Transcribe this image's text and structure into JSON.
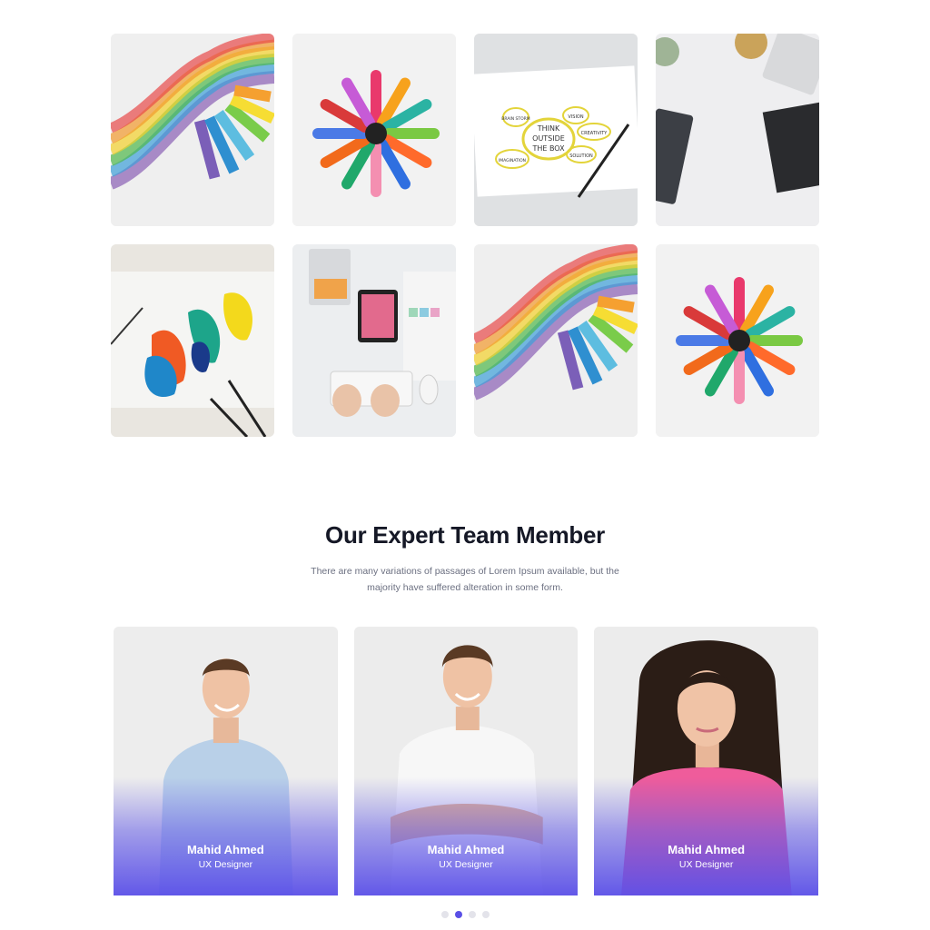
{
  "gallery": {
    "tiles": [
      {
        "alt": "rainbow chalk"
      },
      {
        "alt": "colored markers"
      },
      {
        "alt": "think outside the box"
      },
      {
        "alt": "desk workspace"
      },
      {
        "alt": "paint on paper"
      },
      {
        "alt": "designer desk"
      },
      {
        "alt": "rainbow chalk"
      },
      {
        "alt": "colored markers"
      }
    ],
    "sketch_text": [
      "THINK",
      "OUTSIDE",
      "THE BOX",
      "VISION",
      "CREATIVITY",
      "SOLUTION",
      "BRAIN STORM",
      "IMAGINATION"
    ]
  },
  "team": {
    "heading": "Our Expert Team Member",
    "description": "There are many variations of passages of Lorem Ipsum available, but the majority have suffered alteration in some form.",
    "members": [
      {
        "name": "Mahid Ahmed",
        "role": "UX Designer"
      },
      {
        "name": "Mahid Ahmed",
        "role": "UX Designer"
      },
      {
        "name": "Mahid Ahmed",
        "role": "UX Designer"
      }
    ],
    "carousel": {
      "count": 4,
      "active_index": 1
    }
  },
  "colors": {
    "accent": "#5a50e6",
    "heading": "#151826",
    "body_text": "#6b6f80"
  }
}
